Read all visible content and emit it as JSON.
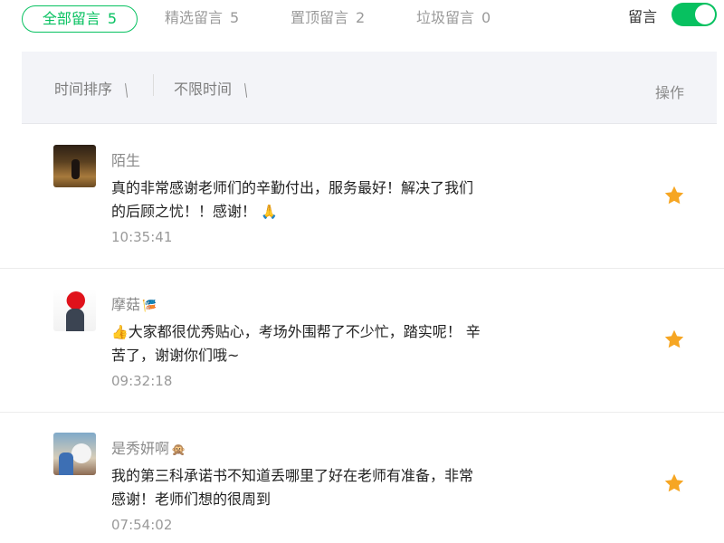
{
  "tabs": [
    {
      "label": "全部留言",
      "count": "5"
    },
    {
      "label": "精选留言",
      "count": "5"
    },
    {
      "label": "置顶留言",
      "count": "2"
    },
    {
      "label": "垃圾留言",
      "count": "0"
    }
  ],
  "toggle": {
    "label": "留言",
    "on": true
  },
  "filter": {
    "sort_label": "时间排序",
    "time_label": "不限时间",
    "action_header": "操作"
  },
  "comments": [
    {
      "name": "陌生",
      "name_emoji": "",
      "text": "真的非常感谢老师们的辛勤付出，服务最好！解决了我们的后顾之忧！！感谢！",
      "text_emoji": "🙏",
      "time": "10:35:41",
      "starred": true
    },
    {
      "name": "摩菇",
      "name_emoji": "🎏",
      "text": "大家都很优秀贴心，考场外围帮了不少忙，踏实呢！ 辛苦了，谢谢你们哦~",
      "lead_emoji": "👍",
      "time": "09:32:18",
      "starred": true
    },
    {
      "name": "是秀妍啊",
      "name_emoji": "🙊",
      "text": "我的第三科承诺书不知道丢哪里了好在老师有准备，非常感谢！老师们想的很周到",
      "time": "07:54:02",
      "starred": true
    }
  ],
  "colors": {
    "accent": "#07c160",
    "star": "#f6a623"
  },
  "icons": {
    "star": "star-icon",
    "edit": "edit-icon"
  }
}
